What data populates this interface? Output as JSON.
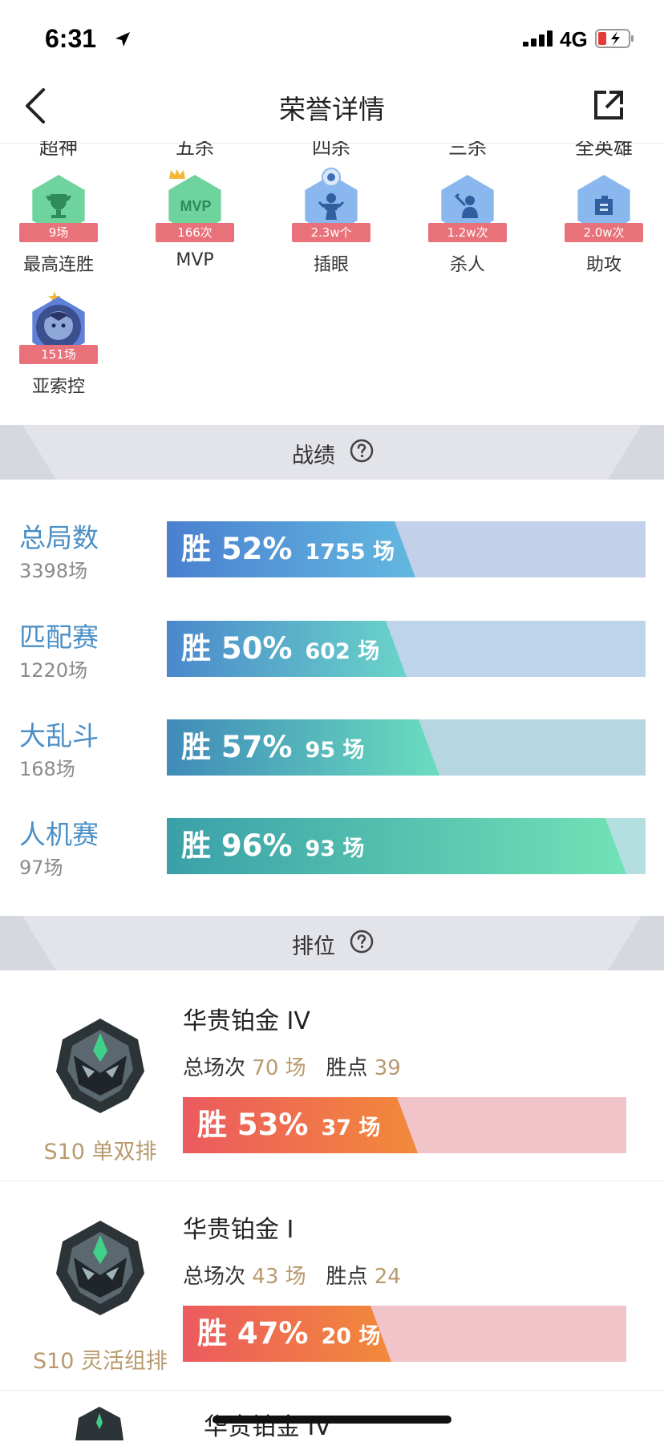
{
  "status_bar": {
    "time": "6:31",
    "network": "4G"
  },
  "nav": {
    "title": "荣誉详情"
  },
  "top_partial_labels": [
    "超神",
    "五杀",
    "四杀",
    "三杀",
    "全英雄"
  ],
  "honors": [
    {
      "label": "最高连胜",
      "value": "9场",
      "icon": "trophy-icon",
      "color": "#6fd39d"
    },
    {
      "label": "MVP",
      "value": "166次",
      "icon": "mvp-icon",
      "color": "#6fd39d"
    },
    {
      "label": "插眼",
      "value": "2.3w个",
      "icon": "ward-icon",
      "color": "#8ab8ee"
    },
    {
      "label": "杀人",
      "value": "1.2w次",
      "icon": "kill-icon",
      "color": "#8ab8ee"
    },
    {
      "label": "助攻",
      "value": "2.0w次",
      "icon": "assist-icon",
      "color": "#8ab8ee"
    },
    {
      "label": "亚索控",
      "value": "151场",
      "icon": "hero-portrait-icon",
      "color": "#6f7fd6"
    }
  ],
  "record_section": {
    "title": "战绩"
  },
  "records": [
    {
      "name": "总局数",
      "count": "3398场",
      "pct_label": "胜 52%",
      "games": "1755 场",
      "win_rate": 0.52,
      "track": "#c3d0ea",
      "grad_from": "#4a80d0",
      "grad_to": "#62b8e0"
    },
    {
      "name": "匹配赛",
      "count": "1220场",
      "pct_label": "胜 50%",
      "games": "602 场",
      "win_rate": 0.5,
      "track": "#bed4ea",
      "grad_from": "#4a88cc",
      "grad_to": "#6ad4c8"
    },
    {
      "name": "大乱斗",
      "count": "168场",
      "pct_label": "胜 57%",
      "games": "95 场",
      "win_rate": 0.57,
      "track": "#b6d6e2",
      "grad_from": "#3f8ab8",
      "grad_to": "#6addbe"
    },
    {
      "name": "人机赛",
      "count": "97场",
      "pct_label": "胜 96%",
      "games": "93 场",
      "win_rate": 0.96,
      "track": "#b3dfe0",
      "grad_from": "#3aa0a8",
      "grad_to": "#72e2b6"
    }
  ],
  "rank_section": {
    "title": "排位"
  },
  "ranks": [
    {
      "tier": "华贵铂金 IV",
      "total_label": "总场次",
      "total": "70 场",
      "points_label": "胜点",
      "points": "39",
      "season": "S10 单双排",
      "pct_label": "胜 53%",
      "games": "37 场",
      "win_rate": 0.53
    },
    {
      "tier": "华贵铂金 I",
      "total_label": "总场次",
      "total": "43 场",
      "points_label": "胜点",
      "points": "24",
      "season": "S10 灵活组排",
      "pct_label": "胜 47%",
      "games": "20 场",
      "win_rate": 0.47
    },
    {
      "tier": "华贵铂金 IV"
    }
  ]
}
